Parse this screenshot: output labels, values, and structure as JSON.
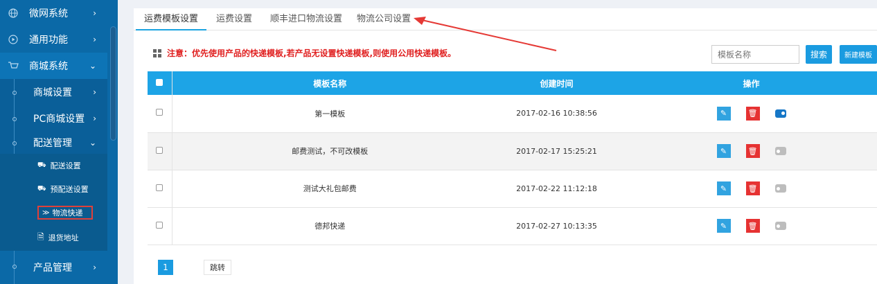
{
  "sidebar": {
    "items": [
      {
        "label": "微网系统",
        "icon": "globe-icon"
      },
      {
        "label": "通用功能",
        "icon": "play-circle-icon"
      },
      {
        "label": "商城系统",
        "icon": "cart-icon"
      }
    ],
    "sub_items": [
      {
        "label": "商城设置"
      },
      {
        "label": "PC商城设置"
      },
      {
        "label": "配送管理"
      }
    ],
    "sub3_items": [
      {
        "label": "配送设置",
        "icon": "truck-icon"
      },
      {
        "label": "预配送设置",
        "icon": "truck-icon"
      },
      {
        "label": "物流快递",
        "icon": "double-chevron-icon"
      },
      {
        "label": "退货地址",
        "icon": "receipt-icon"
      }
    ],
    "bottom_item": {
      "label": "产品管理"
    }
  },
  "tabs": [
    {
      "label": "运费模板设置",
      "active": true
    },
    {
      "label": "运费设置"
    },
    {
      "label": "顺丰进口物流设置"
    },
    {
      "label": "物流公司设置"
    }
  ],
  "notice": "注意：优先使用产品的快递模板,若产品无设置快递模板,则使用公用快递模板。",
  "search": {
    "placeholder": "模板名称",
    "button": "搜索",
    "new_button": "新建模板"
  },
  "table": {
    "headers": [
      "模板名称",
      "创建时间",
      "操作"
    ],
    "rows": [
      {
        "name": "第一模板",
        "time": "2017-02-16 10:38:56",
        "enabled": true
      },
      {
        "name": "邮费测试，不可改模板",
        "time": "2017-02-17 15:25:21",
        "enabled": false
      },
      {
        "name": "测试大礼包邮费",
        "time": "2017-02-22 11:12:18",
        "enabled": false
      },
      {
        "name": "德邦快递",
        "time": "2017-02-27 10:13:35",
        "enabled": false
      }
    ]
  },
  "pager": {
    "current": "1",
    "jump": "跳转"
  },
  "colors": {
    "sidebar": "#0b69a7",
    "accent": "#1da4e6",
    "notice": "#e01f1f",
    "delete": "#e63232"
  }
}
